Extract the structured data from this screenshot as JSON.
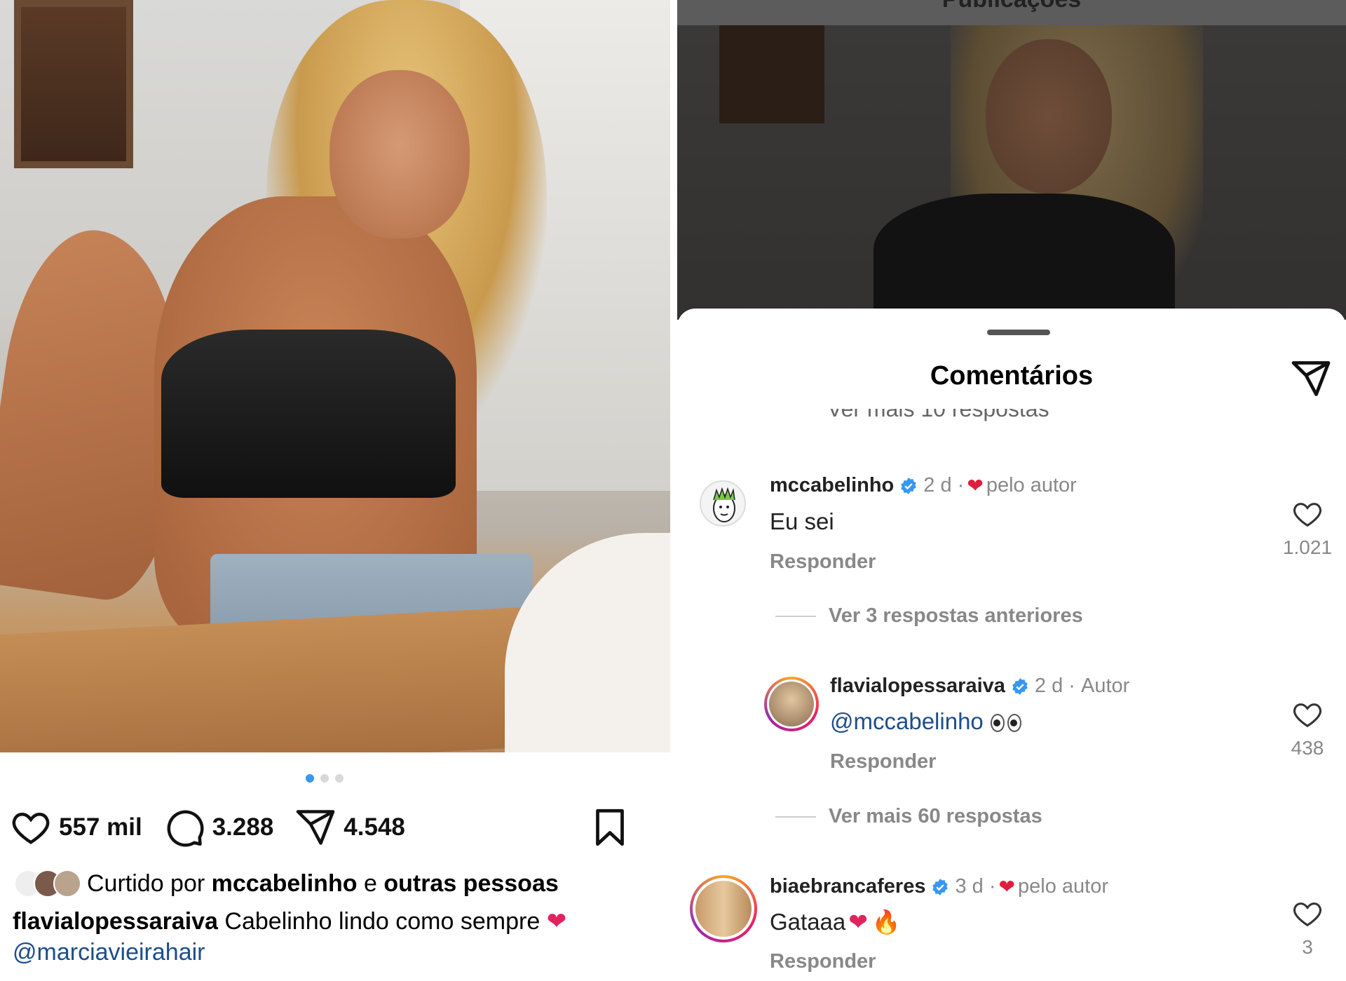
{
  "left_post": {
    "carousel_dots": 3,
    "active_dot": 0,
    "likes": "557 mil",
    "comments": "3.288",
    "shares": "4.548",
    "liked_by_prefix": "Curtido por",
    "liked_by_user": "mccabelinho",
    "liked_by_connector": "e",
    "liked_by_others": "outras pessoas",
    "caption_user": "flavialopessaraiva",
    "caption_text": "Cabelinho lindo como sempre",
    "caption_mention": "@marciavieirahair"
  },
  "right_panel": {
    "topbar_title": "Publicações",
    "sheet_title": "Comentários",
    "cut_text": "Ver mais 10 respostas",
    "comments": [
      {
        "user": "mccabelinho",
        "time": "2 d",
        "meta_sep": "·",
        "badge": "pelo autor",
        "text": "Eu sei",
        "reply": "Responder",
        "likes": "1.021"
      },
      {
        "more": "Ver 3 respostas anteriores"
      },
      {
        "user": "flavialopessaraiva",
        "time": "2 d",
        "meta_sep": "·",
        "badge": "Autor",
        "text": "@mccabelinho",
        "reply": "Responder",
        "likes": "438"
      },
      {
        "more": "Ver mais 60 respostas"
      },
      {
        "user": "biaebrancaferes",
        "time": "3 d",
        "meta_sep": "·",
        "badge": "pelo autor",
        "text": "Gataaa",
        "reply": "Responder",
        "likes": "3"
      }
    ]
  },
  "colors": {
    "accent_blue": "#3897f0",
    "verified_blue": "#3897f0",
    "heart_red": "#e01e3c",
    "mention_blue": "#1c4e8a"
  },
  "icons": [
    "heart-icon",
    "comment-icon",
    "share-icon",
    "bookmark-icon",
    "verified-icon",
    "send-icon"
  ]
}
